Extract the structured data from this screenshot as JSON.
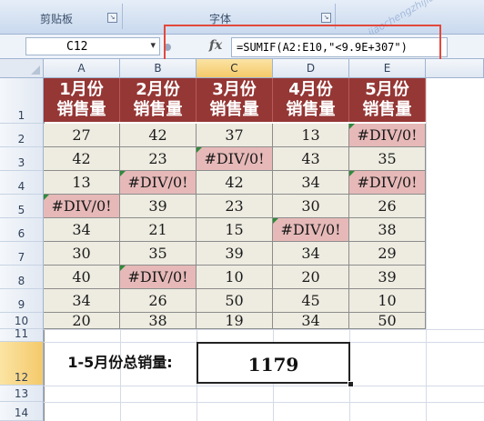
{
  "ribbon": {
    "groups": [
      "剪贴板",
      "字体"
    ]
  },
  "formula_bar": {
    "name_box": "C12",
    "fx_label": "fx",
    "formula": "=SUMIF(A2:E10,\"<9.9E+307\")"
  },
  "grid": {
    "columns": [
      "A",
      "B",
      "C",
      "D",
      "E"
    ],
    "selected_column": "C",
    "rows": [
      "1",
      "2",
      "3",
      "4",
      "5",
      "6",
      "7",
      "8",
      "9",
      "10",
      "11",
      "12",
      "13",
      "14"
    ],
    "selected_row": "12",
    "headers": [
      [
        "1月份",
        "销售量"
      ],
      [
        "2月份",
        "销售量"
      ],
      [
        "3月份",
        "销售量"
      ],
      [
        "4月份",
        "销售量"
      ],
      [
        "5月份",
        "销售量"
      ]
    ],
    "data": [
      [
        "27",
        "42",
        "37",
        "13",
        "#DIV/0!"
      ],
      [
        "42",
        "23",
        "#DIV/0!",
        "43",
        "35"
      ],
      [
        "13",
        "#DIV/0!",
        "42",
        "34",
        "#DIV/0!"
      ],
      [
        "#DIV/0!",
        "39",
        "23",
        "30",
        "26"
      ],
      [
        "34",
        "21",
        "15",
        "#DIV/0!",
        "38"
      ],
      [
        "30",
        "35",
        "39",
        "34",
        "29"
      ],
      [
        "40",
        "#DIV/0!",
        "10",
        "20",
        "39"
      ],
      [
        "34",
        "26",
        "50",
        "45",
        "10"
      ],
      [
        "20",
        "38",
        "19",
        "34",
        "50"
      ]
    ],
    "total_label": "1-5月份总销量:",
    "total_value": "1179"
  },
  "watermark": "jiaochengzhijia",
  "colors": {
    "header_fill": "#953735",
    "cell_fill": "#eeece1",
    "error_fill": "#e6b9b8",
    "highlight_border": "#e2483c"
  }
}
